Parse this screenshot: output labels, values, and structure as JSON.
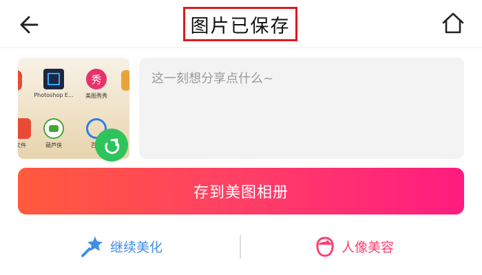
{
  "header": {
    "title": "图片已保存",
    "back_icon": "back-arrow-icon",
    "home_icon": "home-icon"
  },
  "thumbnail": {
    "apps": [
      {
        "label": "Photoshop E...",
        "icon": "photoshop-icon",
        "color": "#1c2840"
      },
      {
        "label": "美图秀秀",
        "icon": "meitu-xiuxiu-icon",
        "glyph": "秀",
        "color": "#e8316b"
      },
      {
        "label": "葫芦侠",
        "icon": "huluxia-icon",
        "color": "#48a437"
      },
      {
        "label": "百度",
        "icon": "baidu-icon",
        "color": "#2d7ce8"
      },
      {
        "label": "文件",
        "icon": "files-icon",
        "color": "#e84a33"
      }
    ],
    "share_icon": "share-icon"
  },
  "caption": {
    "placeholder": "这一刻想分享点什么~"
  },
  "save_button": {
    "label": "存到美图相册"
  },
  "actions": {
    "continue_edit": {
      "label": "继续美化",
      "icon": "magic-wand-icon"
    },
    "portrait_beauty": {
      "label": "人像美容",
      "icon": "portrait-icon"
    }
  },
  "colors": {
    "title_border": "#e0161d",
    "save_gradient_start": "#ff5a3c",
    "save_gradient_end": "#ff1c80",
    "continue_color": "#3f8ee6",
    "portrait_color": "#ff3d6e",
    "share_fab": "#2ec35b"
  }
}
